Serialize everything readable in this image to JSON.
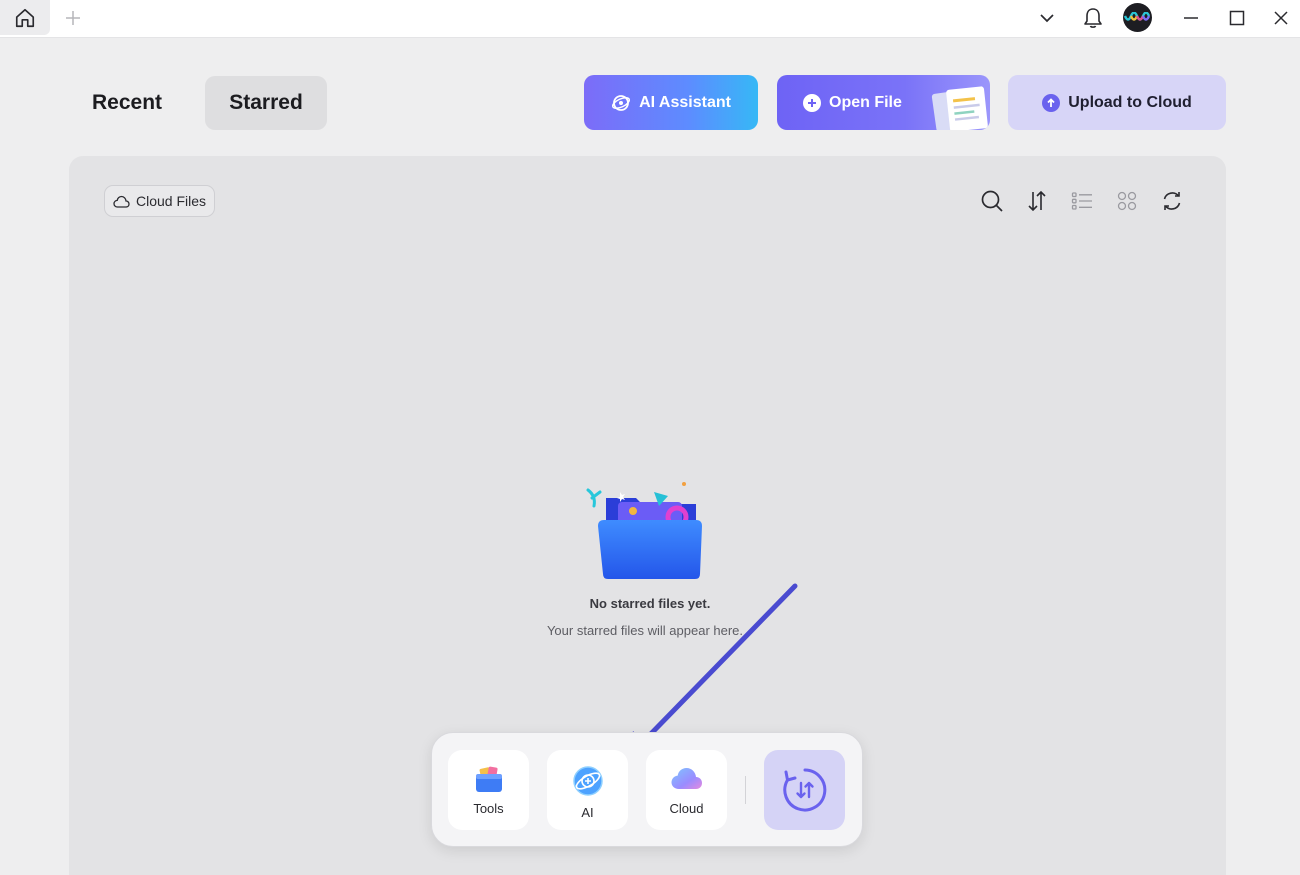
{
  "titlebar": {
    "home_icon": "home-icon",
    "new_tab_icon": "plus-icon",
    "dropdown_icon": "chevron-down-icon",
    "notification_icon": "bell-icon",
    "avatar_icon": "avatar-icon",
    "window_controls": [
      "minimize-icon",
      "maximize-icon",
      "close-icon"
    ]
  },
  "tabs": [
    {
      "label": "Recent",
      "active": false
    },
    {
      "label": "Starred",
      "active": true
    }
  ],
  "actions": {
    "ai_assistant": "AI Assistant",
    "open_file": "Open File",
    "upload_cloud": "Upload to Cloud"
  },
  "panel": {
    "cloud_files_label": "Cloud Files",
    "toolbar_icons": [
      "search-icon",
      "sort-icon",
      "list-view-icon",
      "grid-view-icon",
      "refresh-icon"
    ],
    "empty_title": "No starred files yet.",
    "empty_subtitle": "Your starred files will appear here."
  },
  "dock": {
    "tools_label": "Tools",
    "ai_label": "AI",
    "cloud_label": "Cloud"
  },
  "colors": {
    "accent": "#6e63f5",
    "upload_bg": "#d7d5f7",
    "panel_bg": "#e3e3e5",
    "arrow": "#4a4bd0"
  }
}
